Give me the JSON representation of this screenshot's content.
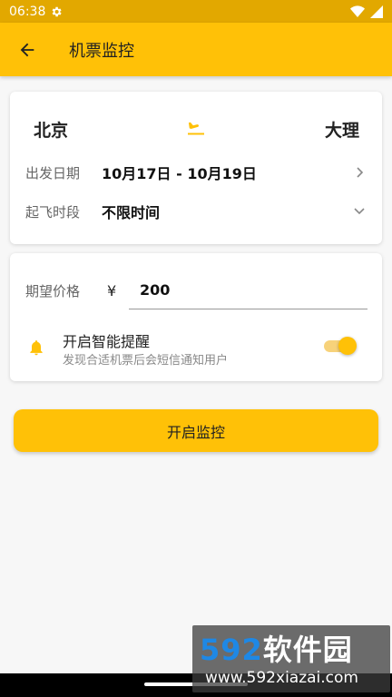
{
  "status_bar": {
    "time": "06:38",
    "settings_icon": "gear-icon",
    "wifi_icon": "wifi-icon",
    "signal_icon": "signal-icon"
  },
  "app_bar": {
    "title": "机票监控",
    "back_icon": "arrow-left-icon"
  },
  "route": {
    "from": "北京",
    "to": "大理",
    "plane_icon": "airplane-landing-icon"
  },
  "departure": {
    "label": "出发日期",
    "value": "10月17日 - 10月19日"
  },
  "time_slot": {
    "label": "起飞时段",
    "value": "不限时间"
  },
  "price": {
    "label": "期望价格",
    "currency": "¥",
    "value": "200"
  },
  "alert": {
    "title": "开启智能提醒",
    "subtitle": "发现合适机票后会短信通知用户",
    "enabled": true
  },
  "start_button": {
    "label": "开启监控"
  },
  "watermark": {
    "brand_num": "592",
    "brand_text": "软件园",
    "url": "www.592xiazai.com"
  },
  "colors": {
    "accent": "#ffc107",
    "status_bar": "#e2a800"
  }
}
